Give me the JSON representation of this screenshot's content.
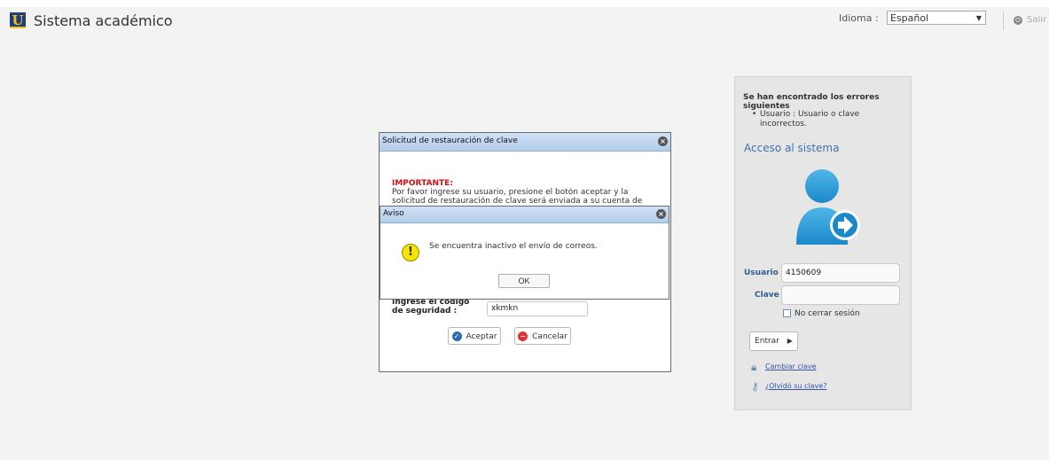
{
  "header": {
    "logo_letter": "U",
    "app_title": "Sistema académico",
    "language_label": "Idioma :",
    "language_value": "Español",
    "exit_label": "Salir"
  },
  "login": {
    "errors_title": "Se han encontrado los errores siguientes",
    "error_items": [
      "Usuario : Usuario o clave incorrectos."
    ],
    "access_title": "Acceso al sistema",
    "user_label": "Usuario :",
    "user_value": "4150609",
    "password_label": "Clave :",
    "password_value": "",
    "keep_session_label": "No cerrar sesión",
    "enter_button": "Entrar",
    "change_password_link": "Cambiar clave",
    "forgot_password_link": "¿Olvidó su clave?"
  },
  "restore_dialog": {
    "title": "Solicitud de restauración de clave",
    "important_label": "IMPORTANTE:",
    "important_text": "Por favor ingrese su usuario, presione el botón aceptar y la solicitud de restauración de clave será enviada a su cuenta de",
    "code_label": "Ingrese el código de seguridad :",
    "code_value": "xkmkn",
    "accept_button": "Aceptar",
    "cancel_button": "Cancelar"
  },
  "alert_dialog": {
    "title": "Aviso",
    "message": "Se encuentra inactivo el envío de correos.",
    "ok_button": "OK"
  },
  "colors": {
    "accent": "#3d73a8",
    "dialog_header": "#c3d8ef",
    "important": "#cc1111",
    "warning": "#f5e400"
  }
}
